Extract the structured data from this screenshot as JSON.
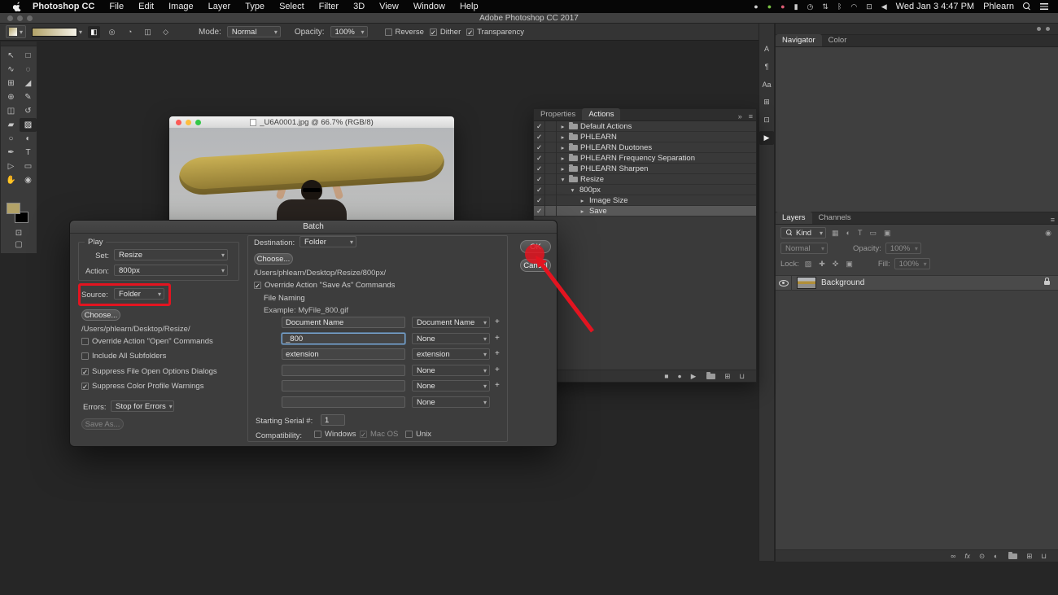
{
  "colors": {
    "annotation_red": "#e31420",
    "focus_blue": "#7aa7d4",
    "foreground_swatch": "#b2a268",
    "background_swatch": "#000000"
  },
  "menubar": {
    "app_name": "Photoshop CC",
    "menus": [
      "File",
      "Edit",
      "Image",
      "Layer",
      "Type",
      "Select",
      "Filter",
      "3D",
      "View",
      "Window",
      "Help"
    ],
    "status_icons": [
      {
        "name": "siri-icon",
        "glyph": "●"
      },
      {
        "name": "dropbox-icon",
        "glyph": "●"
      },
      {
        "name": "creative-cloud-icon",
        "glyph": "●"
      },
      {
        "name": "battery-icon",
        "glyph": "▮"
      },
      {
        "name": "time-machine-icon",
        "glyph": "◷"
      },
      {
        "name": "sync-icon",
        "glyph": "⇅"
      },
      {
        "name": "bluetooth-icon",
        "glyph": "ᛒ"
      },
      {
        "name": "wifi-icon",
        "glyph": "◠"
      },
      {
        "name": "display-icon",
        "glyph": "⊡"
      },
      {
        "name": "volume-icon",
        "glyph": "◀"
      }
    ],
    "clock": "Wed Jan 3  4:47 PM",
    "user": "Phlearn"
  },
  "titlebar": {
    "title": "Adobe Photoshop CC 2017"
  },
  "options": {
    "mode_label": "Mode:",
    "mode_value": "Normal",
    "opacity_label": "Opacity:",
    "opacity_value": "100%",
    "checks": [
      {
        "label": "Reverse",
        "mark": ""
      },
      {
        "label": "Dither",
        "mark": "✓"
      },
      {
        "label": "Transparency",
        "mark": "✓"
      }
    ],
    "gradient_types": [
      {
        "name": "linear-gradient-icon",
        "glyph": "◧"
      },
      {
        "name": "radial-gradient-icon",
        "glyph": "◎"
      },
      {
        "name": "angle-gradient-icon",
        "glyph": "◔"
      },
      {
        "name": "reflected-gradient-icon",
        "glyph": "◫"
      },
      {
        "name": "diamond-gradient-icon",
        "glyph": "◇"
      }
    ]
  },
  "tools": [
    {
      "name": "move-tool",
      "glyph": "↖"
    },
    {
      "name": "rectangular-marquee-tool",
      "glyph": "□"
    },
    {
      "name": "lasso-tool",
      "glyph": "∿"
    },
    {
      "name": "quick-selection-tool",
      "glyph": "◌"
    },
    {
      "name": "crop-tool",
      "glyph": "⊞"
    },
    {
      "name": "eyedropper-tool",
      "glyph": "◢"
    },
    {
      "name": "spot-healing-brush-tool",
      "glyph": "⊕"
    },
    {
      "name": "brush-tool",
      "glyph": "✎"
    },
    {
      "name": "clone-stamp-tool",
      "glyph": "◫"
    },
    {
      "name": "history-brush-tool",
      "glyph": "↺"
    },
    {
      "name": "eraser-tool",
      "glyph": "▰"
    },
    {
      "name": "gradient-tool",
      "glyph": "▨"
    },
    {
      "name": "blur-tool",
      "glyph": "○"
    },
    {
      "name": "dodge-tool",
      "glyph": "◐"
    },
    {
      "name": "pen-tool",
      "glyph": "✒"
    },
    {
      "name": "type-tool",
      "glyph": "T"
    },
    {
      "name": "path-selection-tool",
      "glyph": "▷"
    },
    {
      "name": "rectangle-tool",
      "glyph": "▭"
    },
    {
      "name": "hand-tool",
      "glyph": "✋"
    },
    {
      "name": "zoom-tool",
      "glyph": "◉"
    }
  ],
  "document": {
    "title": "_U6A0001.jpg @ 66.7% (RGB/8)"
  },
  "batch": {
    "title": "Batch",
    "play_label": "Play",
    "set_label": "Set:",
    "set_value": "Resize",
    "action_label": "Action:",
    "action_value": "800px",
    "source_label": "Source:",
    "source_value": "Folder",
    "source_choose_label": "Choose...",
    "source_path": "/Users/phlearn/Desktop/Resize/",
    "options": [
      {
        "label": "Override Action \"Open\" Commands",
        "mark": ""
      },
      {
        "label": "Include All Subfolders",
        "mark": ""
      },
      {
        "label": "Suppress File Open Options Dialogs",
        "mark": "✓"
      },
      {
        "label": "Suppress Color Profile Warnings",
        "mark": "✓"
      }
    ],
    "errors_label": "Errors:",
    "errors_value": "Stop for Errors",
    "save_as_label": "Save As...",
    "destination_label": "Destination:",
    "destination_value": "Folder",
    "destination_choose_label": "Choose...",
    "destination_path": "/Users/phlearn/Desktop/Resize/800px/",
    "override_save": {
      "label": "Override Action \"Save As\" Commands",
      "mark": "✓"
    },
    "file_naming_label": "File Naming",
    "example": "Example: MyFile_800.gif",
    "naming_rows": [
      {
        "value": "Document Name",
        "option": "Document Name",
        "plus": "+"
      },
      {
        "value": "_800",
        "option": "None",
        "plus": "+"
      },
      {
        "value": "extension",
        "option": "extension",
        "plus": "+"
      },
      {
        "value": "",
        "option": "None",
        "plus": "+"
      },
      {
        "value": "",
        "option": "None",
        "plus": "+"
      },
      {
        "value": "",
        "option": "None",
        "plus": ""
      }
    ],
    "serial_label": "Starting Serial #:",
    "serial_value": "1",
    "compat_label": "Compatibility:",
    "compat": [
      {
        "label": "Windows",
        "mark": ""
      },
      {
        "label": "Mac OS",
        "mark": "✓"
      },
      {
        "label": "Unix",
        "mark": ""
      }
    ],
    "ok_label": "OK",
    "cancel_label": "Cancel"
  },
  "actions": {
    "tabs": [
      "Properties",
      "Actions"
    ],
    "collapse_icon": "»",
    "menu_icon": "≡",
    "rows": [
      {
        "check": "✓",
        "expander": "▸",
        "label": "Default Actions"
      },
      {
        "check": "✓",
        "expander": "▸",
        "label": "PHLEARN"
      },
      {
        "check": "✓",
        "expander": "▸",
        "label": "PHLEARN Duotones"
      },
      {
        "check": "✓",
        "expander": "▸",
        "label": "PHLEARN Frequency Separation"
      },
      {
        "check": "✓",
        "expander": "▸",
        "label": "PHLEARN Sharpen"
      },
      {
        "check": "✓",
        "expander": "▾",
        "label": "Resize"
      },
      {
        "check": "✓",
        "expander": "▾",
        "label": "800px"
      },
      {
        "check": "✓",
        "expander": "▸",
        "label": "Image Size"
      },
      {
        "check": "✓",
        "expander": "▸",
        "label": "Save"
      }
    ],
    "footer": [
      {
        "name": "stop-icon",
        "glyph": "■"
      },
      {
        "name": "record-icon",
        "glyph": "●"
      },
      {
        "name": "play-icon",
        "glyph": "▶"
      },
      {
        "name": "new-folder-icon",
        "glyph": ""
      },
      {
        "name": "new-action-icon",
        "glyph": "⊞"
      },
      {
        "name": "delete-icon",
        "glyph": "⊔"
      }
    ]
  },
  "dock": {
    "collapsed_icons": [
      {
        "name": "character-panel-icon",
        "glyph": "A"
      },
      {
        "name": "paragraph-panel-icon",
        "glyph": "¶"
      },
      {
        "name": "glyphs-panel-icon",
        "glyph": "Aa"
      },
      {
        "name": "swatches-panel-icon",
        "glyph": "⊞"
      },
      {
        "name": "clone-source-panel-icon",
        "glyph": "⊡"
      },
      {
        "name": "actions-panel-icon",
        "glyph": "▶"
      }
    ],
    "nav_tabs": [
      "Navigator",
      "Color"
    ],
    "layers": {
      "tabs": [
        "Layers",
        "Channels"
      ],
      "menu_icon": "≡",
      "kind_label": "Kind",
      "filter_icons": [
        {
          "name": "filter-pixel-layers-icon",
          "glyph": "▦"
        },
        {
          "name": "filter-adjustment-layers-icon",
          "glyph": "◐"
        },
        {
          "name": "filter-type-layers-icon",
          "glyph": "T"
        },
        {
          "name": "filter-shape-layers-icon",
          "glyph": "▭"
        },
        {
          "name": "filter-smart-objects-icon",
          "glyph": "▣"
        }
      ],
      "blend_mode": "Normal",
      "opacity_label": "Opacity:",
      "opacity_value": "100%",
      "lock_label": "Lock:",
      "lock_icons": [
        {
          "name": "lock-transparency-icon",
          "glyph": "▨"
        },
        {
          "name": "lock-pixels-icon",
          "glyph": "✚"
        },
        {
          "name": "lock-position-icon",
          "glyph": "✜"
        },
        {
          "name": "lock-all-icon",
          "glyph": "▣"
        }
      ],
      "fill_label": "Fill:",
      "fill_value": "100%",
      "background_layer": "Background",
      "footer": [
        {
          "name": "link-layers-icon",
          "glyph": "∞"
        },
        {
          "name": "layer-effects-icon",
          "glyph": "fx"
        },
        {
          "name": "layer-mask-icon",
          "glyph": "⊙"
        },
        {
          "name": "adjustment-layer-icon",
          "glyph": "◐"
        },
        {
          "name": "layer-group-icon",
          "glyph": ""
        },
        {
          "name": "new-layer-icon",
          "glyph": "⊞"
        },
        {
          "name": "delete-layer-icon",
          "glyph": "⊔"
        }
      ]
    }
  }
}
